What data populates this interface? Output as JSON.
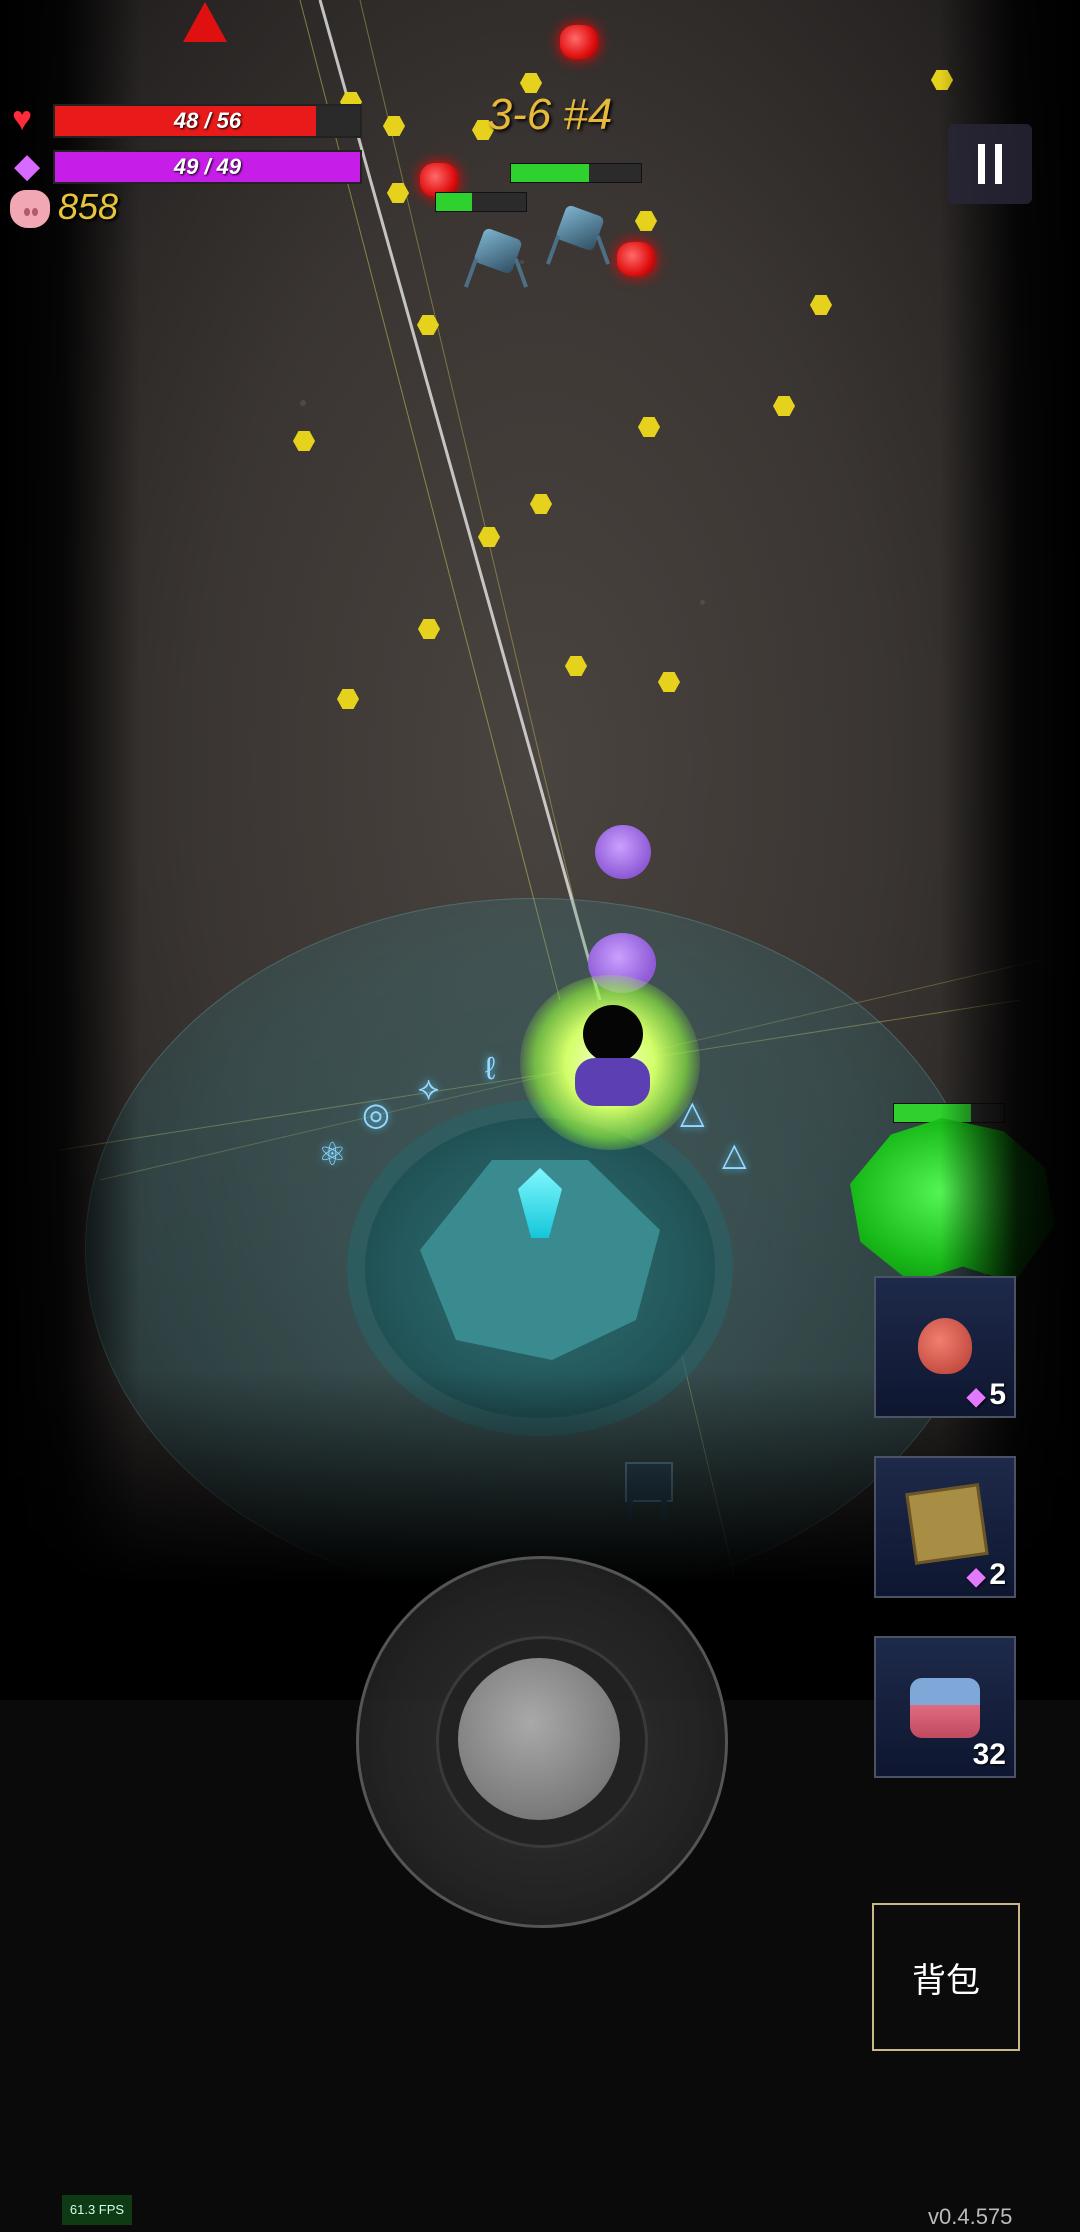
{
  "hud": {
    "hp_text": "48 / 56",
    "hp_fraction": 0.857,
    "hp_color": "#e81a1a",
    "mana_text": "49 / 49",
    "mana_fraction": 1.0,
    "mana_color": "#c61ee8",
    "coins": "858",
    "level_label": "3-6 #4"
  },
  "items": [
    {
      "name": "potion-flask",
      "count": "5",
      "cost_gem": true
    },
    {
      "name": "rune-cube",
      "count": "2",
      "cost_gem": true
    },
    {
      "name": "health-bottle",
      "count": "32",
      "cost_gem": false
    }
  ],
  "enemies": {
    "spider_left_health": 0.4,
    "spider_right_health": 0.6,
    "golem_health": 0.7
  },
  "buttons": {
    "bag_label": "背包"
  },
  "footer": {
    "fps": "61.3 FPS",
    "version": "v0.4.575"
  },
  "icons": {
    "hp": "heart-icon",
    "mana": "diamond-gem-icon",
    "coins": "pig-icon",
    "pause": "pause-icon"
  }
}
